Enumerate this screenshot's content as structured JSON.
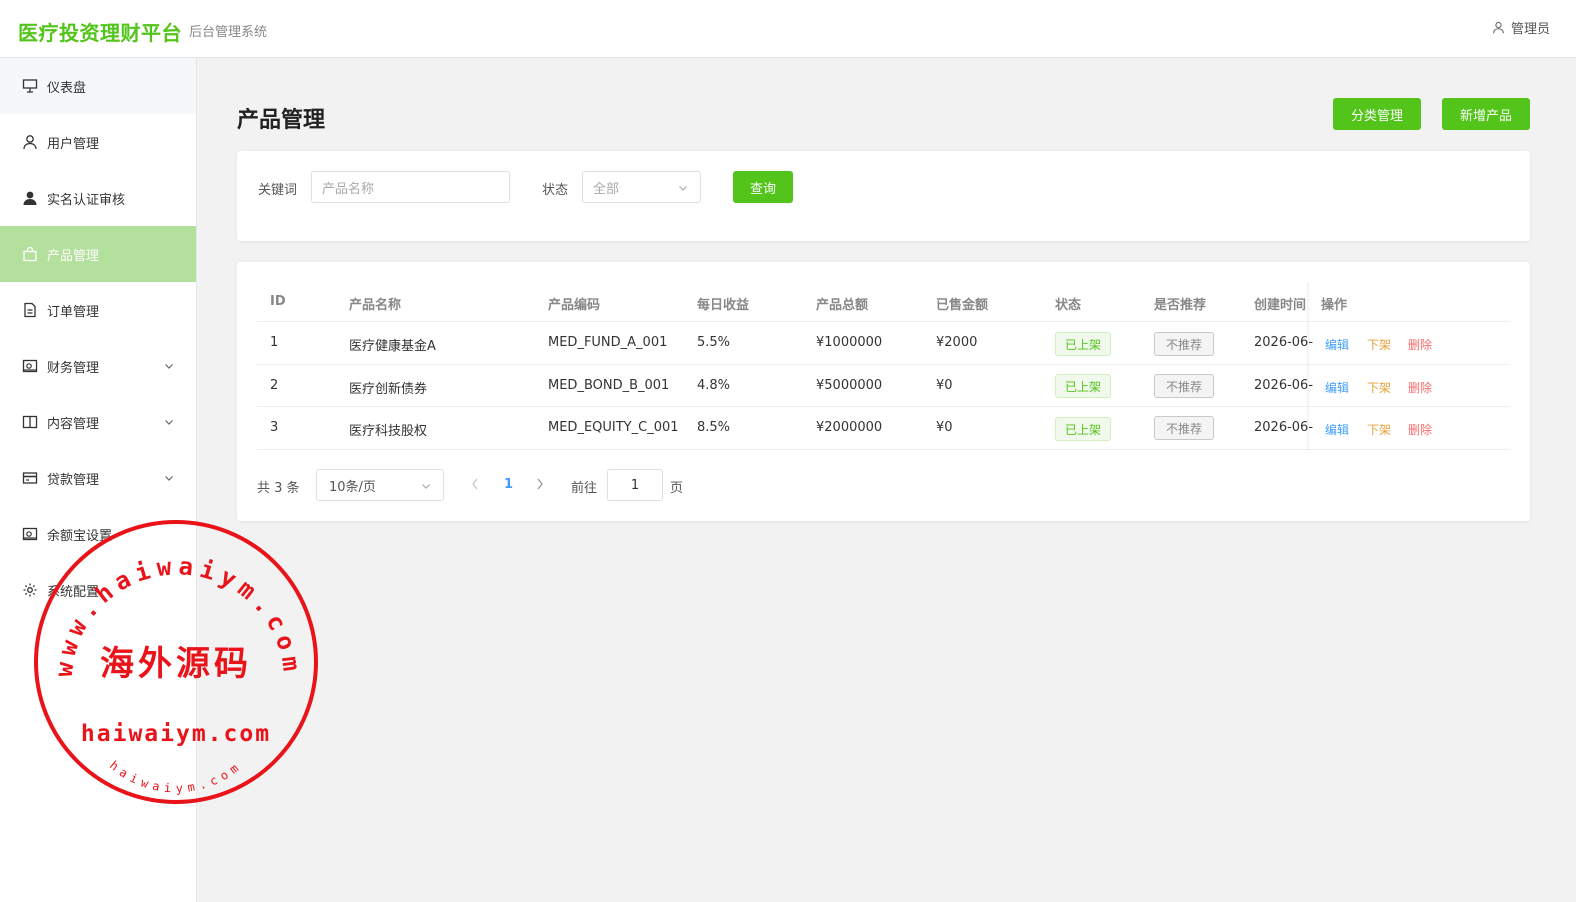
{
  "header": {
    "brand": "医疗投资理财平台",
    "subtitle": "后台管理系统",
    "user": "管理员"
  },
  "sidebar": {
    "items": [
      {
        "label": "仪表盘",
        "icon": "presentation-icon"
      },
      {
        "label": "用户管理",
        "icon": "user-icon"
      },
      {
        "label": "实名认证审核",
        "icon": "user-filled-icon"
      },
      {
        "label": "产品管理",
        "icon": "bag-icon",
        "active": true
      },
      {
        "label": "订单管理",
        "icon": "document-icon"
      },
      {
        "label": "财务管理",
        "icon": "wallet-icon",
        "expandable": true
      },
      {
        "label": "内容管理",
        "icon": "book-icon",
        "expandable": true
      },
      {
        "label": "贷款管理",
        "icon": "card-icon",
        "expandable": true
      },
      {
        "label": "余额宝设置",
        "icon": "wallet-icon"
      },
      {
        "label": "系统配置",
        "icon": "gear-icon"
      }
    ]
  },
  "page": {
    "title": "产品管理",
    "category_button": "分类管理",
    "new_button": "新增产品"
  },
  "search": {
    "keyword_label": "关键词",
    "keyword_placeholder": "产品名称",
    "status_label": "状态",
    "status_value": "全部",
    "query_button": "查询"
  },
  "table": {
    "headers": [
      "ID",
      "产品名称",
      "产品编码",
      "每日收益",
      "产品总额",
      "已售金额",
      "状态",
      "是否推荐",
      "创建时间",
      "操作"
    ],
    "rows": [
      {
        "id": "1",
        "name": "医疗健康基金A",
        "code": "MED_FUND_A_001",
        "daily": "5.5%",
        "total": "¥1000000",
        "sold": "¥2000",
        "status": "已上架",
        "recommend": "不推荐",
        "created": "2026-06-"
      },
      {
        "id": "2",
        "name": "医疗创新债券",
        "code": "MED_BOND_B_001",
        "daily": "4.8%",
        "total": "¥5000000",
        "sold": "¥0",
        "status": "已上架",
        "recommend": "不推荐",
        "created": "2026-06-"
      },
      {
        "id": "3",
        "name": "医疗科技股权",
        "code": "MED_EQUITY_C_001",
        "daily": "8.5%",
        "total": "¥2000000",
        "sold": "¥0",
        "status": "已上架",
        "recommend": "不推荐",
        "created": "2026-06-"
      }
    ],
    "actions": {
      "edit": "编辑",
      "offshelf": "下架",
      "delete": "删除"
    }
  },
  "pagination": {
    "total": "共 3 条",
    "page_size": "10条/页",
    "current": "1",
    "goto_label": "前往",
    "goto_value": "1",
    "page_suffix": "页"
  },
  "watermark": {
    "url_top": "www.haiwaiym.com",
    "center": "海外源码",
    "url_main": "haiwaiym.com",
    "url_small": "haiwaiym.com"
  },
  "colors": {
    "brand": "#52c41a",
    "active_bg": "#b3e19d",
    "link": "#409eff",
    "warning": "#e6a23c",
    "danger": "#f56c6c",
    "stamp": "#e8141a"
  }
}
